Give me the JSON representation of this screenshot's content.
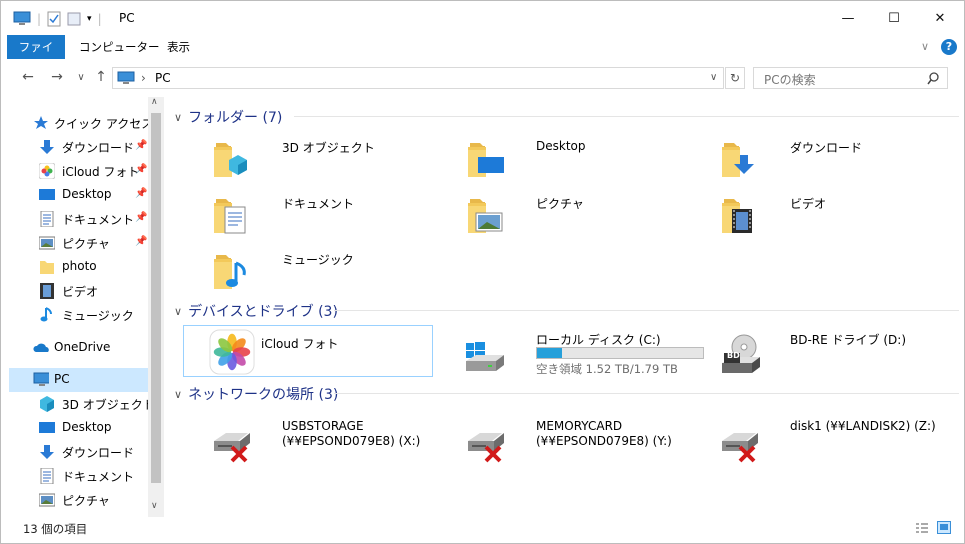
{
  "window": {
    "title": "PC",
    "minimize": "—",
    "maximize": "☐",
    "close": "✕"
  },
  "ribbon": {
    "tabs": [
      {
        "label": "ファイル"
      },
      {
        "label": "コンピューター"
      },
      {
        "label": "表示"
      }
    ],
    "help": "?"
  },
  "nav": {
    "back": "←",
    "forward": "→",
    "recent": "∨",
    "up": "↑",
    "breadcrumb": "PC",
    "refresh": "↻"
  },
  "search": {
    "placeholder": "PCの検索"
  },
  "sidebar": {
    "items": [
      {
        "label": "クイック アクセス",
        "icon": "star-icon"
      },
      {
        "label": "ダウンロード",
        "icon": "download-icon",
        "pinned": true
      },
      {
        "label": "iCloud フォト",
        "icon": "photos-icon",
        "pinned": true
      },
      {
        "label": "Desktop",
        "icon": "desktop-icon",
        "pinned": true
      },
      {
        "label": "ドキュメント",
        "icon": "document-icon",
        "pinned": true
      },
      {
        "label": "ピクチャ",
        "icon": "picture-icon",
        "pinned": true
      },
      {
        "label": "photo",
        "icon": "folder-icon"
      },
      {
        "label": "ビデオ",
        "icon": "video-icon"
      },
      {
        "label": "ミュージック",
        "icon": "music-icon"
      },
      {
        "label": "OneDrive",
        "icon": "cloud-icon"
      },
      {
        "label": "PC",
        "icon": "pc-icon",
        "selected": true
      },
      {
        "label": "3D オブジェクト",
        "icon": "cube-icon"
      },
      {
        "label": "Desktop",
        "icon": "desktop-icon"
      },
      {
        "label": "ダウンロード",
        "icon": "download-icon"
      },
      {
        "label": "ドキュメント",
        "icon": "document-icon"
      },
      {
        "label": "ピクチャ",
        "icon": "picture-icon"
      }
    ]
  },
  "groups": {
    "folders": {
      "label": "フォルダー (7)",
      "items": [
        {
          "name": "3D オブジェクト",
          "icon": "cube-folder-icon"
        },
        {
          "name": "Desktop",
          "icon": "desktop-folder-icon"
        },
        {
          "name": "ダウンロード",
          "icon": "download-folder-icon"
        },
        {
          "name": "ドキュメント",
          "icon": "document-folder-icon"
        },
        {
          "name": "ピクチャ",
          "icon": "picture-folder-icon"
        },
        {
          "name": "ビデオ",
          "icon": "video-folder-icon"
        },
        {
          "name": "ミュージック",
          "icon": "music-folder-icon"
        }
      ]
    },
    "drives": {
      "label": "デバイスとドライブ (3)",
      "items": [
        {
          "name": "iCloud フォト",
          "icon": "icloud-photos-icon"
        },
        {
          "name": "ローカル ディスク (C:)",
          "free": "空き領域 1.52 TB/1.79 TB",
          "used_fraction": 0.15,
          "icon": "windows-drive-icon"
        },
        {
          "name": "BD-RE ドライブ (D:)",
          "icon": "bd-drive-icon",
          "badge": "BD"
        }
      ]
    },
    "network": {
      "label": "ネットワークの場所 (3)",
      "items": [
        {
          "name": "USBSTORAGE",
          "sub": "(¥¥EPSOND079E8) (X:)",
          "icon": "network-drive-disconnected-icon"
        },
        {
          "name": "MEMORYCARD",
          "sub": "(¥¥EPSOND079E8) (Y:)",
          "icon": "network-drive-disconnected-icon"
        },
        {
          "name": "disk1 (¥¥LANDISK2) (Z:)",
          "icon": "network-drive-disconnected-icon"
        }
      ]
    }
  },
  "status": {
    "count": "13 個の項目"
  },
  "colors": {
    "accent": "#1979ca",
    "selected": "#cce8ff",
    "group_header": "#1e3287",
    "folder": "#f8d775",
    "bar": "#26a0da",
    "error": "#d11a1a"
  }
}
